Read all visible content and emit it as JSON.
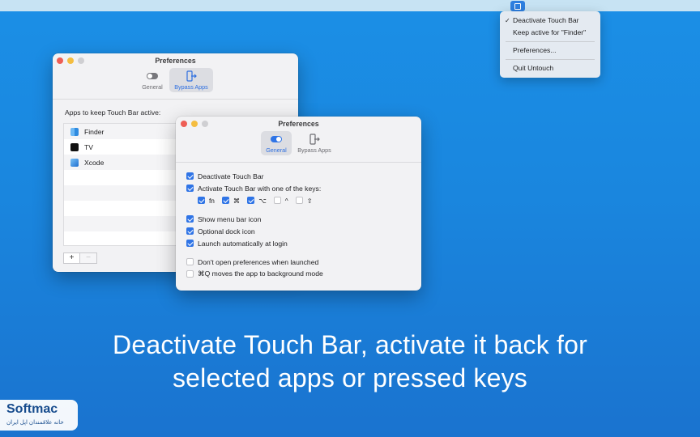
{
  "menubar": {
    "app_icon": "untouch-menubar-icon",
    "menu": {
      "items": [
        {
          "label": "Deactivate Touch Bar",
          "checked": true
        },
        {
          "label": "Keep active for \"Finder\"",
          "checked": false
        },
        {
          "label": "Preferences...",
          "checked": false
        },
        {
          "label": "Quit Untouch",
          "checked": false
        }
      ]
    }
  },
  "back_window": {
    "title": "Preferences",
    "tabs": [
      {
        "label": "General",
        "icon": "toggle-icon",
        "active": false
      },
      {
        "label": "Bypass Apps",
        "icon": "bypass-icon",
        "active": true
      }
    ],
    "apps_label": "Apps to keep Touch Bar active:",
    "apps": [
      {
        "name": "Finder",
        "icon": "finder-icon"
      },
      {
        "name": "TV",
        "icon": "tv-icon"
      },
      {
        "name": "Xcode",
        "icon": "xcode-icon"
      }
    ],
    "add_label": "+",
    "remove_label": "−"
  },
  "front_window": {
    "title": "Preferences",
    "tabs": [
      {
        "label": "General",
        "icon": "toggle-icon",
        "active": true
      },
      {
        "label": "Bypass Apps",
        "icon": "bypass-icon",
        "active": false
      }
    ],
    "settings": {
      "deactivate": {
        "label": "Deactivate Touch Bar",
        "checked": true
      },
      "activate_keys": {
        "label": "Activate Touch Bar with one of the keys:",
        "checked": true
      },
      "keys": [
        {
          "label": "fn",
          "checked": true
        },
        {
          "label": "⌘",
          "checked": true
        },
        {
          "label": "⌥",
          "checked": true
        },
        {
          "label": "^",
          "checked": false
        },
        {
          "label": "⇧",
          "checked": false
        }
      ],
      "menu_icon": {
        "label": "Show menu bar icon",
        "checked": true
      },
      "dock_icon": {
        "label": "Optional dock icon",
        "checked": true
      },
      "launch_login": {
        "label": "Launch automatically at login",
        "checked": true
      },
      "dont_open": {
        "label": "Don't open preferences when launched",
        "checked": false
      },
      "cmdq": {
        "label": "⌘Q moves the app to background mode",
        "checked": false
      }
    }
  },
  "caption": {
    "line1": "Deactivate Touch Bar, activate it back for",
    "line2": "selected apps or pressed keys"
  },
  "watermark": {
    "brand": "Softmac",
    "subtitle": "خانه علاقمندان اپل ایران"
  },
  "colors": {
    "accent": "#2f74e6",
    "background": "#1a86de"
  }
}
